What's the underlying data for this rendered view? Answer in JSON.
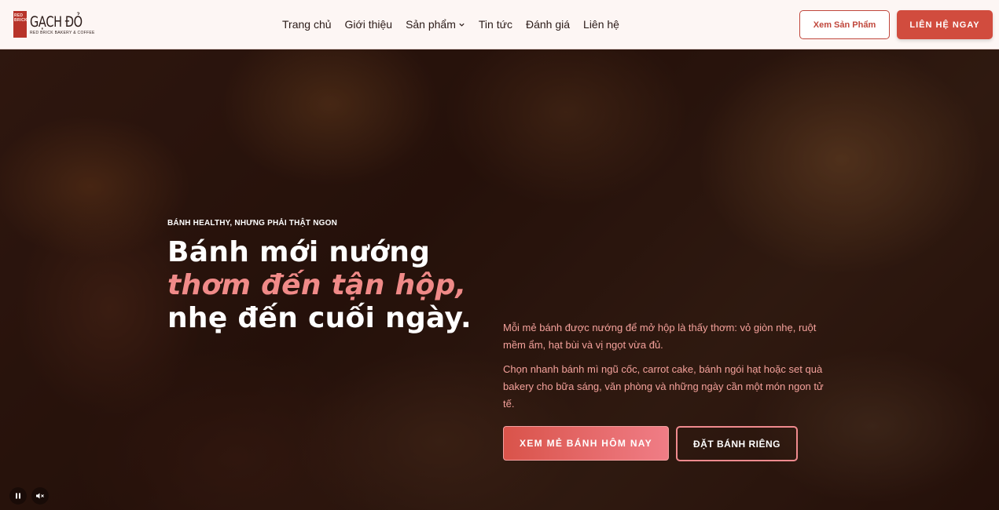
{
  "brand": {
    "mark_text": "RED BRICK",
    "name": "GẠCH ĐỎ",
    "tagline": "RED BRICK BAKERY & COFFEE"
  },
  "nav": {
    "items": [
      {
        "label": "Trang chủ"
      },
      {
        "label": "Giới thiệu"
      },
      {
        "label": "Sản phẩm",
        "has_dropdown": true
      },
      {
        "label": "Tin tức"
      },
      {
        "label": "Đánh giá"
      },
      {
        "label": "Liên hệ"
      }
    ]
  },
  "header_actions": {
    "view_products": "Xem Sản Phẩm",
    "contact_now": "LIÊN HỆ NGAY"
  },
  "hero": {
    "eyebrow": "BÁNH HEALTHY, NHƯNG PHẢI THẬT NGON",
    "headline_part1": "Bánh mới nướng ",
    "headline_accent": "thơm đến tận hộp,",
    "headline_part2": " nhẹ đến cuối ngày.",
    "paragraph1": "Mỗi mẻ bánh được nướng để mở hộp là thấy thơm: vỏ giòn nhẹ, ruột mềm ẩm, hạt bùi và vị ngọt vừa đủ.",
    "paragraph2": "Chọn nhanh bánh mì ngũ cốc, carrot cake, bánh ngói hạt hoặc set quà bakery cho bữa sáng, văn phòng và những ngày cần một món ngon tử tế.",
    "primary_cta": "XEM MẺ BÁNH HÔM NAY",
    "secondary_cta": "ĐẶT BÁNH RIÊNG"
  },
  "video_controls": {
    "pause_icon": "pause-icon",
    "mute_icon": "mute-icon"
  },
  "colors": {
    "brand_red": "#d14c3e",
    "accent_pink": "#f08a88",
    "header_bg": "#fdf6f4"
  }
}
